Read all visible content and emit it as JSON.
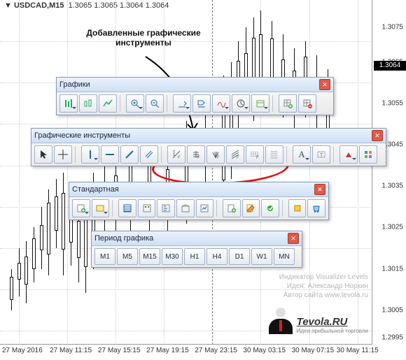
{
  "symbol": {
    "pair": "USDCAD",
    "tf": "M15",
    "ohlc": "1.3065 1.3065 1.3064 1.3064"
  },
  "annotation": {
    "line1": "Добавленные графические",
    "line2": "инструменты"
  },
  "price_axis": {
    "ticks": [
      "1.3075",
      "1.3065",
      "1.3055",
      "1.3045",
      "1.3035",
      "1.3025",
      "1.3015",
      "1.3005",
      "1.2995"
    ],
    "current": "1.3064"
  },
  "time_axis": [
    "27 May 2016",
    "27 May 11:15",
    "27 May 15:15",
    "27 May 19:15",
    "27 May 23:15",
    "30 May 03:15",
    "30 May 07:15",
    "30 May 11:15"
  ],
  "toolbars": {
    "charts": {
      "title": "Графики"
    },
    "drawing": {
      "title": "Графические инструменты"
    },
    "standard": {
      "title": "Стандартная"
    },
    "period": {
      "title": "Период графика",
      "items": [
        "M1",
        "M5",
        "M15",
        "M30",
        "H1",
        "H4",
        "D1",
        "W1",
        "MN"
      ]
    }
  },
  "credits": {
    "l1": "Индикатор Visualizer Levels",
    "l2": "Идея: Александр Норкин",
    "l3": "Автор сайта www.tevola.ru"
  },
  "brand": {
    "name": "Tevola.RU",
    "sub": "Идеи прибыльной торговли"
  }
}
